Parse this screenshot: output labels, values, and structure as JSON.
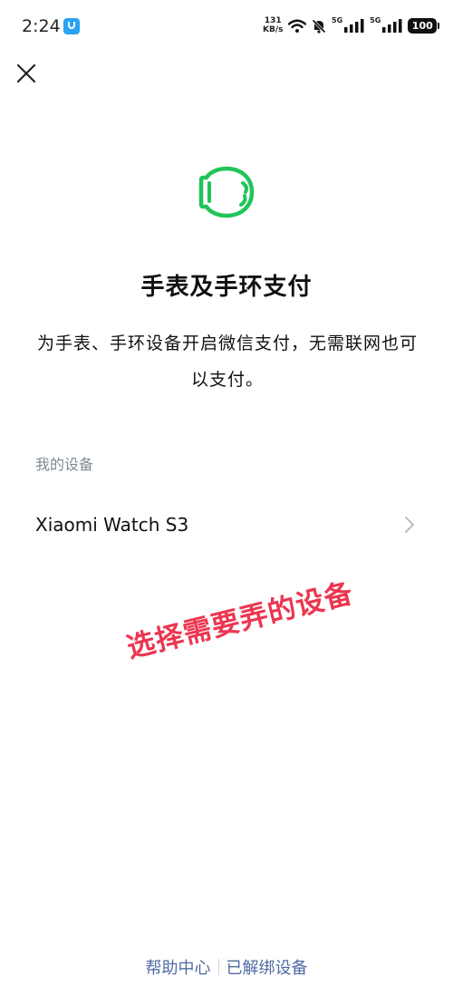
{
  "status_bar": {
    "time": "2:24",
    "net_speed_value": "131",
    "net_speed_unit": "KB/s",
    "signal_1_label": "5G",
    "signal_2_label": "5G",
    "battery": "100"
  },
  "icons": {
    "close": "close-icon",
    "watch": "watch-icon",
    "chevron": "chevron-right-icon"
  },
  "page": {
    "title": "手表及手环支付",
    "description": "为手表、手环设备开启微信支付，无需联网也可以支付。"
  },
  "devices": {
    "section_label": "我的设备",
    "items": [
      {
        "name": "Xiaomi Watch S3"
      }
    ]
  },
  "annotation": "选择需要弄的设备",
  "footer": {
    "help_center": "帮助中心",
    "unbound_devices": "已解绑设备"
  },
  "colors": {
    "accent_green": "#21c45a",
    "link_blue": "#4f6ca1",
    "annotation_red": "#ec3650",
    "muted_gray": "#808a94"
  }
}
